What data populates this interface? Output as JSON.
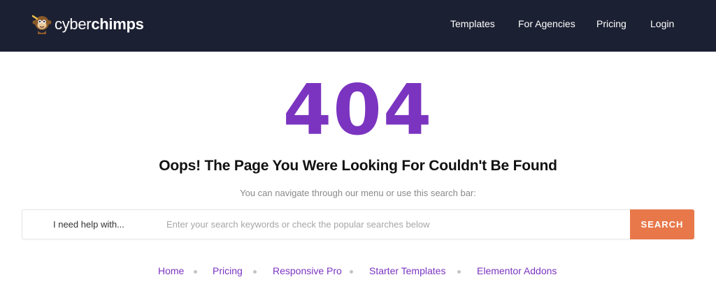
{
  "header": {
    "logo": {
      "text_light": "cyber",
      "text_bold": "chimps",
      "icon": "chimp-mascot-icon"
    },
    "nav": [
      {
        "label": "Templates"
      },
      {
        "label": "For Agencies"
      },
      {
        "label": "Pricing"
      },
      {
        "label": "Login"
      }
    ]
  },
  "error": {
    "code": "404",
    "headline": "Oops! The Page You Were Looking For Couldn't Be Found",
    "subtext": "You can navigate through our menu or use this search bar:"
  },
  "search": {
    "label": "I need help with...",
    "placeholder": "Enter your search keywords or check the popular searches below",
    "value": "",
    "button_label": "SEARCH"
  },
  "popular_links": [
    {
      "label": "Home"
    },
    {
      "label": "Pricing"
    },
    {
      "label": "Responsive Pro"
    },
    {
      "label": "Starter Templates"
    },
    {
      "label": "Elementor Addons"
    }
  ],
  "colors": {
    "header_bg": "#1c2033",
    "accent_purple": "#7b34c0",
    "search_button": "#e8784a"
  }
}
